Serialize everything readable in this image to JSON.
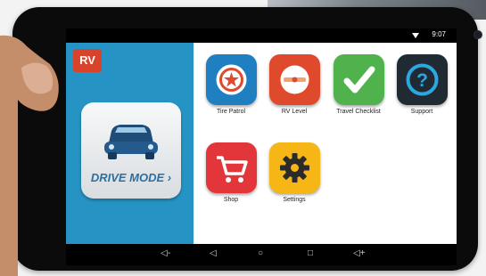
{
  "status": {
    "time": "9:07"
  },
  "sidebar": {
    "logo": "RV",
    "drive_mode": "DRIVE MODE ›"
  },
  "apps": [
    {
      "label": "Tire Patrol",
      "color": "#1f7fc1",
      "icon": "tire-patrol-icon"
    },
    {
      "label": "RV Level",
      "color": "#e04a2c",
      "icon": "rv-level-icon"
    },
    {
      "label": "Travel Checklist",
      "color": "#4fb24d",
      "icon": "checkmark-icon"
    },
    {
      "label": "Support",
      "color": "#1f2a33",
      "icon": "question-mark-icon"
    },
    {
      "label": "Shop",
      "color": "#e3363a",
      "icon": "shopping-cart-icon"
    },
    {
      "label": "Settings",
      "color": "#f6b615",
      "icon": "gear-icon"
    }
  ],
  "navbar": {
    "volume_down": "◁-",
    "back": "◁",
    "home": "○",
    "recents": "□",
    "volume_up": "◁+"
  }
}
